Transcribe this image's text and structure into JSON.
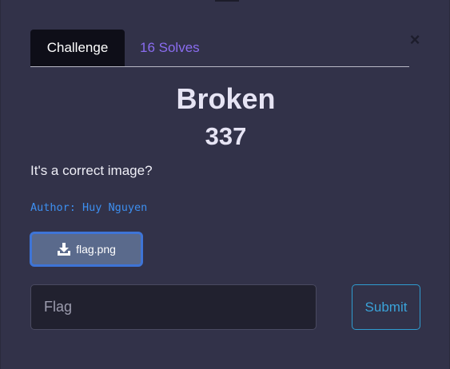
{
  "tabs": {
    "challenge": "Challenge",
    "solves": "16 Solves"
  },
  "close_symbol": "×",
  "challenge": {
    "name": "Broken",
    "points": "337",
    "description": "It's a correct image?",
    "author": "Author: Huy Nguyen"
  },
  "file": {
    "name": "flag.png",
    "icon": "download-icon"
  },
  "flag_input": {
    "placeholder": "Flag",
    "value": ""
  },
  "submit_label": "Submit",
  "colors": {
    "background": "#323249",
    "tab_active_bg": "#0e0e18",
    "solves_link": "#8a6cf0",
    "author_text": "#3d8ff0",
    "file_button": "#5a6a8c",
    "submit_accent": "#3aa3d9"
  }
}
